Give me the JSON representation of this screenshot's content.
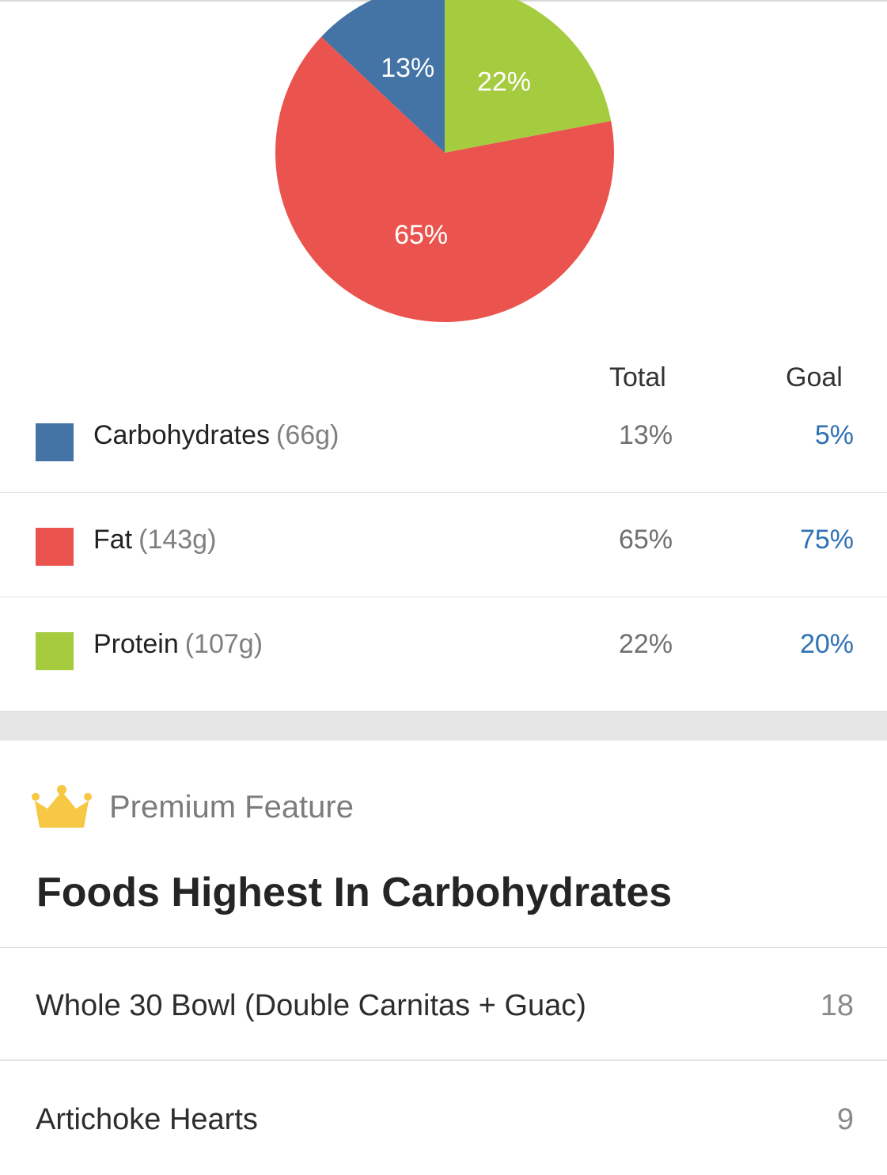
{
  "colors": {
    "carbohydrates": "#4474a6",
    "fat": "#eb544e",
    "protein": "#a5cb3f",
    "goal_text": "#2f72b4",
    "crown": "#f6c843"
  },
  "chart_data": {
    "type": "pie",
    "slices": [
      {
        "label": "Protein",
        "value": 22,
        "color": "#a5cb3f",
        "display": "22%"
      },
      {
        "label": "Fat",
        "value": 65,
        "color": "#eb544e",
        "display": "65%"
      },
      {
        "label": "Carbohydrates",
        "value": 13,
        "color": "#4474a6",
        "display": "13%"
      }
    ]
  },
  "table": {
    "headers": {
      "total": "Total",
      "goal": "Goal"
    },
    "rows": [
      {
        "name": "Carbohydrates",
        "grams": "(66g)",
        "total": "13%",
        "goal": "5%",
        "color": "#4474a6"
      },
      {
        "name": "Fat",
        "grams": "(143g)",
        "total": "65%",
        "goal": "75%",
        "color": "#eb544e"
      },
      {
        "name": "Protein",
        "grams": "(107g)",
        "total": "22%",
        "goal": "20%",
        "color": "#a5cb3f"
      }
    ]
  },
  "premium": {
    "icon": "crown-icon",
    "label": "Premium Feature"
  },
  "foods": {
    "title": "Foods Highest In Carbohydrates",
    "items": [
      {
        "name": "Whole 30 Bowl (Double Carnitas + Guac)",
        "value": "18"
      },
      {
        "name": "Artichoke Hearts",
        "value": "9"
      }
    ]
  }
}
